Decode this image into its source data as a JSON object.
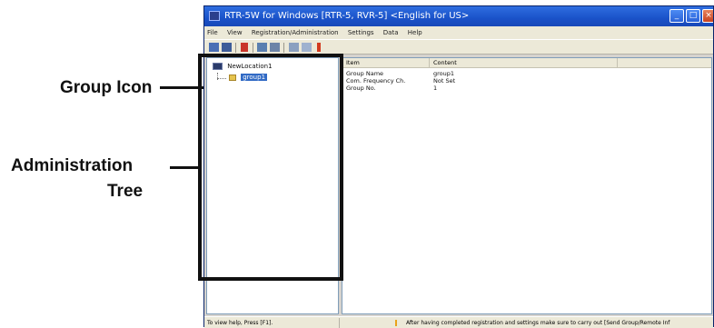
{
  "callouts": {
    "group_icon": "Group Icon",
    "admin_tree_line1": "Administration",
    "admin_tree_line2": "Tree"
  },
  "window": {
    "title": "RTR-5W for Windows [RTR-5, RVR-5] <English for US>",
    "min_glyph": "_",
    "max_glyph": "□",
    "close_glyph": "×"
  },
  "menu": [
    "File",
    "View",
    "Registration/Administration",
    "Settings",
    "Data",
    "Help"
  ],
  "tree": {
    "root": "NewLocation1",
    "group": "group1"
  },
  "list": {
    "headers": [
      "Item",
      "Content",
      ""
    ],
    "rows": [
      {
        "item": "Group Name",
        "content": "group1"
      },
      {
        "item": "Com. Frequency Ch.",
        "content": "Not Set"
      },
      {
        "item": "Group No.",
        "content": "1"
      }
    ]
  },
  "status": {
    "left": "To view help, Press [F1].",
    "right": "After having completed registration and settings make sure to carry out [Send Group/Remote Inf"
  },
  "colors": {
    "title_blue": "#1a52c9",
    "selection": "#316ac5",
    "annotation": "#111111"
  }
}
